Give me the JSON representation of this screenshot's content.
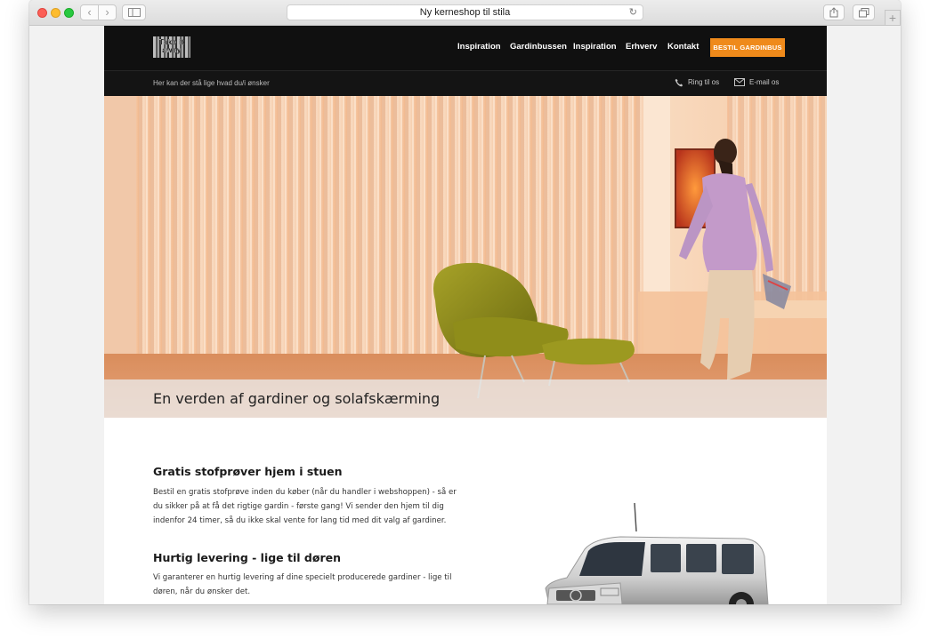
{
  "browser": {
    "url_title": "Ny kerneshop til stila",
    "back": "‹",
    "forward": "›",
    "reload_icon": "reload-icon",
    "plus": "+"
  },
  "header": {
    "logo_text": "Take it away",
    "menu": [
      "Inspiration",
      "Gardinbussen",
      "Inspiration",
      "Erhverv",
      "Kontakt"
    ],
    "cta": "BESTIL GARDINBUS",
    "cta_color": "#ef8a1b",
    "tagline": "Her kan der stå lige hvad du/i ønsker",
    "phone": "Ring til os",
    "email": "E-mail os"
  },
  "hero": {
    "title": "En verden af gardiner og solafskærming"
  },
  "sections": [
    {
      "title": "Gratis stofprøver hjem i stuen",
      "body": "Bestil en gratis stofprøve inden du køber (når du handler i webshoppen) - så er du sikker på at få det rigtige gardin - første gang! Vi sender den hjem til dig indenfor 24 timer, så du ikke skal vente for lang tid med dit valg af gardiner."
    },
    {
      "title": "Hurtig levering - lige til døren",
      "body": "Vi garanterer en hurtig levering af dine specielt producerede gardiner - lige til døren, når du ønsker det."
    }
  ]
}
